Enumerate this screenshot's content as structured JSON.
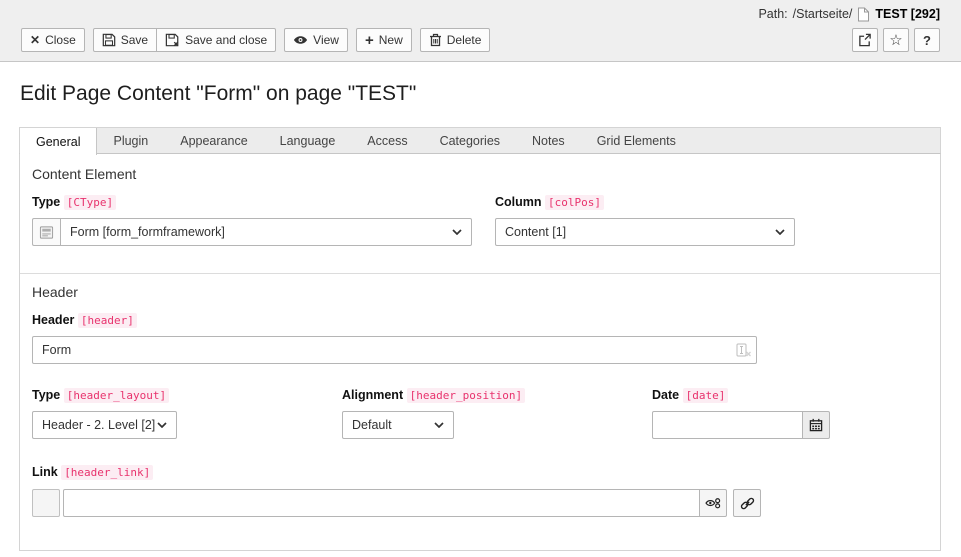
{
  "topbar": {
    "path_label": "Path:",
    "path_value": "/Startseite/",
    "page_ref": "TEST [292]"
  },
  "toolbar": {
    "close": "Close",
    "save": "Save",
    "save_and_close": "Save and close",
    "view": "View",
    "new": "New",
    "delete": "Delete"
  },
  "icons": {
    "close": "✕",
    "plus": "+",
    "star": "☆",
    "help": "?"
  },
  "page": {
    "title": "Edit Page Content \"Form\" on page \"TEST\""
  },
  "tabs": {
    "items": [
      "General",
      "Plugin",
      "Appearance",
      "Language",
      "Access",
      "Categories",
      "Notes",
      "Grid Elements"
    ],
    "active": "General"
  },
  "content_element": {
    "heading": "Content Element",
    "type": {
      "label": "Type",
      "tag": "[CType]",
      "value": "Form [form_formframework]"
    },
    "column": {
      "label": "Column",
      "tag": "[colPos]",
      "value": "Content [1]"
    }
  },
  "header_section": {
    "heading": "Header",
    "header_field": {
      "label": "Header",
      "tag": "[header]",
      "value": "Form"
    },
    "type_field": {
      "label": "Type",
      "tag": "[header_layout]",
      "value": "Header - 2. Level [2]"
    },
    "alignment_field": {
      "label": "Alignment",
      "tag": "[header_position]",
      "value": "Default"
    },
    "date_field": {
      "label": "Date",
      "tag": "[date]",
      "value": ""
    },
    "link_field": {
      "label": "Link",
      "tag": "[header_link]",
      "value": ""
    }
  },
  "colors": {
    "accent_pink": "#e8326d",
    "tag_background": "#fcedf3",
    "docheader_background": "#efefef",
    "border": "#d4d4d4"
  }
}
